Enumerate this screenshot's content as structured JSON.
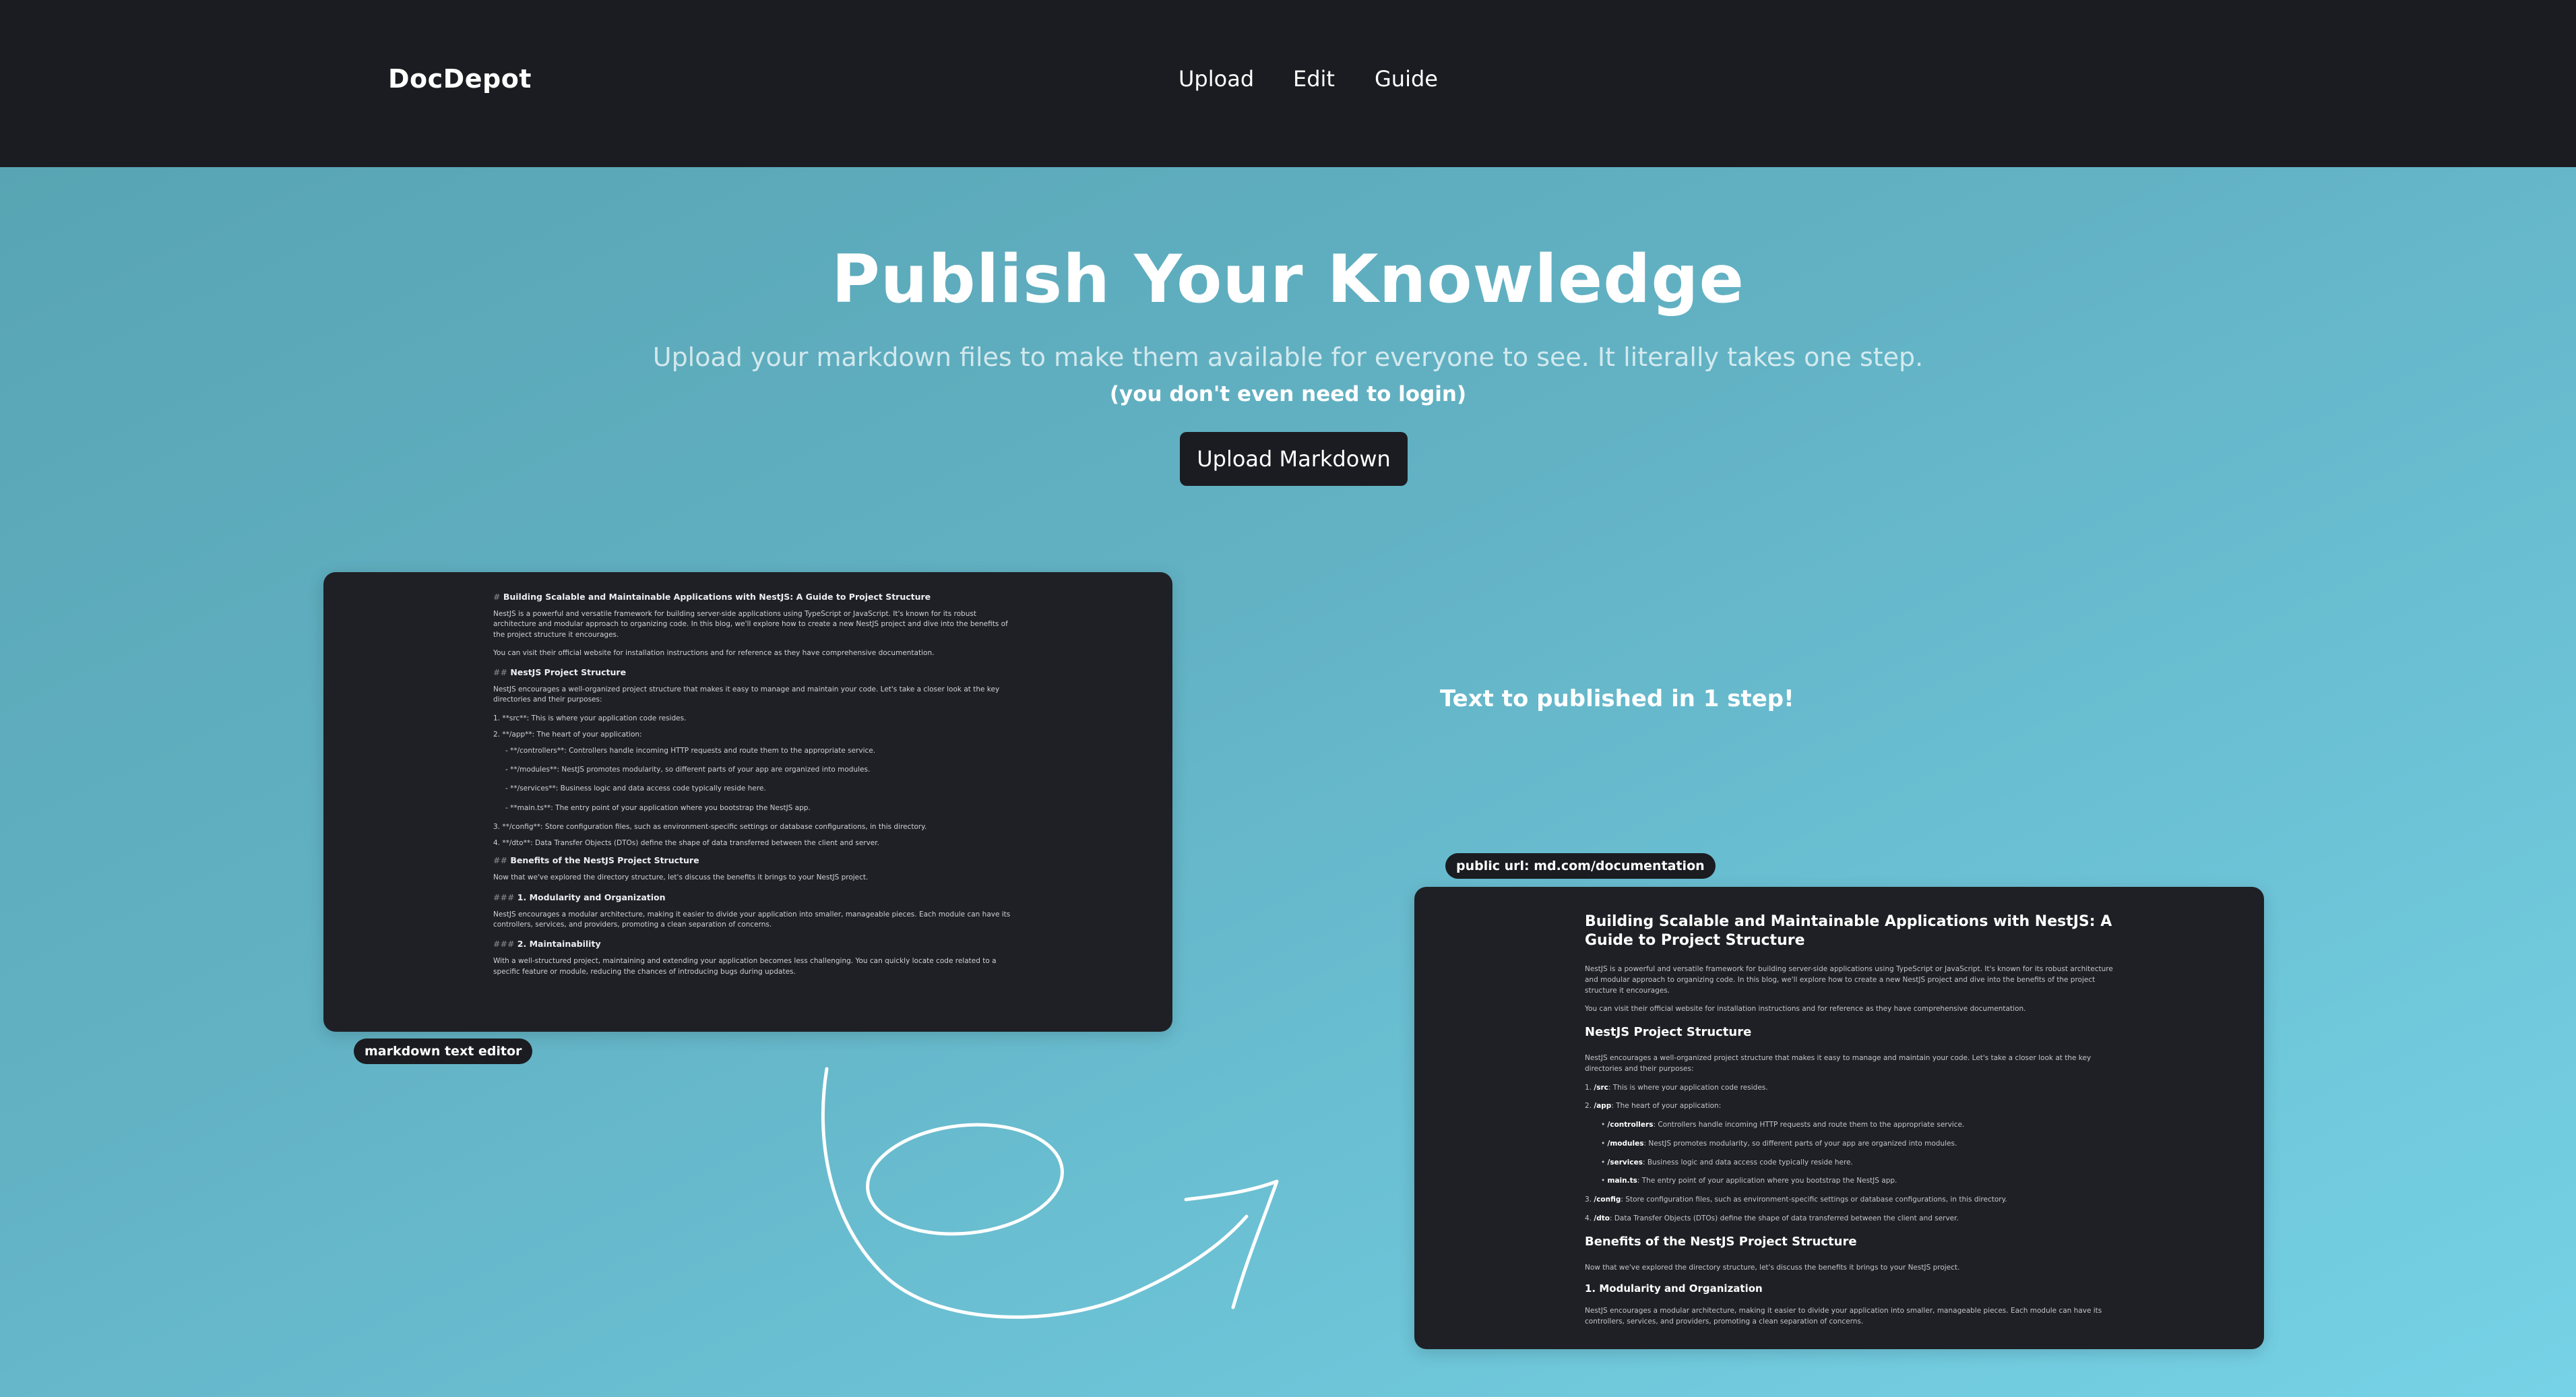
{
  "header": {
    "logo": "DocDepot",
    "nav": [
      "Upload",
      "Edit",
      "Guide"
    ]
  },
  "hero": {
    "title": "Publish Your Knowledge",
    "subtitle": "Upload your markdown files to make them available for everyone to see. It literally takes one step.",
    "note": "(you don't even need to login)",
    "cta_label": "Upload Markdown"
  },
  "editor": {
    "pill_label": "markdown text editor",
    "title_hash": "#",
    "title": "Building Scalable and Maintainable Applications with NestJS: A Guide to Project Structure",
    "intro": "NestJS is a powerful and versatile framework for building server-side applications using TypeScript or JavaScript. It's known for its robust architecture and modular approach to organizing code. In this blog, we'll explore how to create a new NestJS project and dive into the benefits of the project structure it encourages.",
    "visit": "You can visit their official website for installation instructions and for reference as they have comprehensive documentation.",
    "h_structure_hash": "##",
    "h_structure": "NestJS Project Structure",
    "structure_intro": "NestJS encourages a well-organized project structure that makes it easy to manage and maintain your code. Let's take a closer look at the key directories and their purposes:",
    "li1": "1. **src**: This is where your application code resides.",
    "li2": "2. **/app**: The heart of your application:",
    "sub1": "- **/controllers**: Controllers handle incoming HTTP requests and route them to the appropriate service.",
    "sub2": "- **/modules**: NestJS promotes modularity, so different parts of your app are organized into modules.",
    "sub3": "- **/services**: Business logic and data access code typically reside here.",
    "sub4": "- **main.ts**: The entry point of your application where you bootstrap the NestJS app.",
    "li3": "3. **/config**: Store configuration files, such as environment-specific settings or database configurations, in this directory.",
    "li4": "4. **/dto**: Data Transfer Objects (DTOs) define the shape of data transferred between the client and server.",
    "h_benefits_hash": "##",
    "h_benefits": "Benefits of the NestJS Project Structure",
    "benefits_intro": "Now that we've explored the directory structure, let's discuss the benefits it brings to your NestJS project.",
    "h_mod_hash": "###",
    "h_mod": "1. Modularity and Organization",
    "mod_text": "NestJS encourages a modular architecture, making it easier to divide your application into smaller, manageable pieces. Each module can have its controllers, services, and providers, promoting a clean separation of concerns.",
    "h_maint_hash": "###",
    "h_maint": "2. Maintainability",
    "maint_text": "With a well-structured project, maintaining and extending your application becomes less challenging. You can quickly locate code related to a specific feature or module, reducing the chances of introducing bugs during updates."
  },
  "middle": {
    "step_text": "Text to published in 1 step!"
  },
  "published": {
    "pill_label": "public url: md.com/documentation",
    "title": "Building Scalable and Maintainable Applications with NestJS: A Guide to Project Structure",
    "intro": "NestJS is a powerful and versatile framework for building server-side applications using TypeScript or JavaScript. It's known for its robust architecture and modular approach to organizing code. In this blog, we'll explore how to create a new NestJS project and dive into the benefits of the project structure it encourages.",
    "visit": "You can visit their official website for installation instructions and for reference as they have comprehensive documentation.",
    "h_structure": "NestJS Project Structure",
    "structure_intro": "NestJS encourages a well-organized project structure that makes it easy to manage and maintain your code. Let's take a closer look at the key directories and their purposes:",
    "li1_num": "1.",
    "li1_b": "/src",
    "li1_t": ": This is where your application code resides.",
    "li2_num": "2.",
    "li2_b": "/app",
    "li2_t": ": The heart of your application:",
    "sub1_b": "/controllers",
    "sub1_t": ": Controllers handle incoming HTTP requests and route them to the appropriate service.",
    "sub2_b": "/modules",
    "sub2_t": ": NestJS promotes modularity, so different parts of your app are organized into modules.",
    "sub3_b": "/services",
    "sub3_t": ": Business logic and data access code typically reside here.",
    "sub4_b": "main.ts",
    "sub4_t": ": The entry point of your application where you bootstrap the NestJS app.",
    "li3_num": "3.",
    "li3_b": "/config",
    "li3_t": ": Store configuration files, such as environment-specific settings or database configurations, in this directory.",
    "li4_num": "4.",
    "li4_b": "/dto",
    "li4_t": ": Data Transfer Objects (DTOs) define the shape of data transferred between the client and server.",
    "h_benefits": "Benefits of the NestJS Project Structure",
    "benefits_intro": "Now that we've explored the directory structure, let's discuss the benefits it brings to your NestJS project.",
    "h_mod": "1. Modularity and Organization",
    "mod_text": "NestJS encourages a modular architecture, making it easier to divide your application into smaller, manageable pieces. Each module can have its controllers, services, and providers, promoting a clean separation of concerns."
  },
  "colors": {
    "header_bg": "#1b1c21",
    "card_bg": "#1f2025",
    "gradient_start": "#56a2b1",
    "gradient_end": "#76d2e6"
  },
  "icons": [
    "loop-arrow-icon"
  ]
}
